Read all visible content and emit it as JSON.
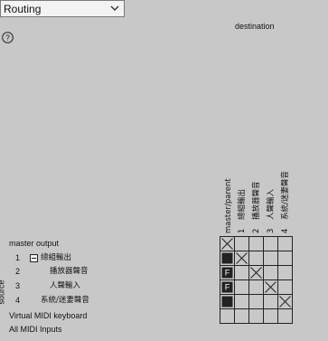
{
  "dropdown": {
    "value": "Routing"
  },
  "help_icon": "question-circle-icon",
  "destination_label": "destination",
  "source_label": "source",
  "columns": [
    {
      "number": "",
      "name": "master/parent"
    },
    {
      "number": "1",
      "name": "總組輸出"
    },
    {
      "number": "2",
      "name": "播放器聲音"
    },
    {
      "number": "3",
      "name": "人聲輸入"
    },
    {
      "number": "4",
      "name": "系統/迷妻聲音"
    }
  ],
  "rows": {
    "master": {
      "label": "master output"
    },
    "items": [
      {
        "number": "1",
        "name": "總組輸出",
        "collapsible": true
      },
      {
        "number": "2",
        "name": "播放器聲音",
        "collapsible": false
      },
      {
        "number": "3",
        "name": "人聲輸入",
        "collapsible": false
      },
      {
        "number": "4",
        "name": "系統/迷妻聲音",
        "collapsible": false
      }
    ],
    "virtual_keyboard": {
      "label": "Virtual MIDI keyboard"
    },
    "all_midi": {
      "label": "All MIDI Inputs"
    }
  },
  "parent_cells": [
    {
      "state": "x"
    },
    {
      "state": "filled"
    },
    {
      "state": "F"
    },
    {
      "state": "F"
    },
    {
      "state": "filled"
    }
  ],
  "matrix_marks": [
    {
      "row": 1,
      "col": 1,
      "state": "x"
    },
    {
      "row": 2,
      "col": 2,
      "state": "x"
    },
    {
      "row": 3,
      "col": 3,
      "state": "x"
    },
    {
      "row": 4,
      "col": 4,
      "state": "x"
    }
  ],
  "colors": {
    "background": "#c8c8c8",
    "grid_line": "#222222",
    "cell_fill": "#222222",
    "cell_text": "#ffffff"
  }
}
